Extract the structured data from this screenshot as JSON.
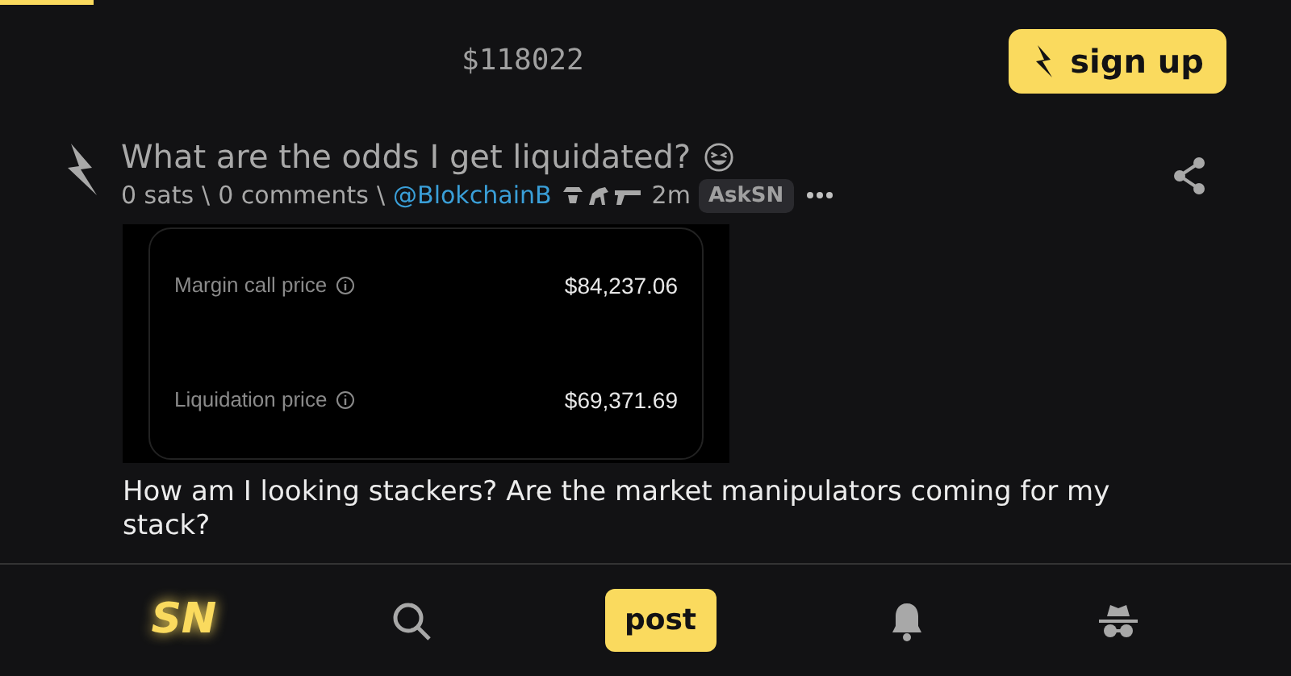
{
  "header": {
    "price": "$118022",
    "signup": "sign up"
  },
  "post": {
    "title": "What are the odds I get liquidated?",
    "sats": "0 sats",
    "comments": "0 comments",
    "separators": [
      "\\",
      "\\"
    ],
    "author": "@BlokchainB",
    "age": "2m",
    "tag": "AskSN",
    "screenshot": {
      "rows": [
        {
          "label": "Margin call price",
          "value": "$84,237.06"
        },
        {
          "label": "Liquidation price",
          "value": "$69,371.69"
        }
      ]
    },
    "body": "How am I looking stackers? Are the market manipulators coming for my stack?"
  },
  "nav": {
    "logo": "SN",
    "post": "post"
  }
}
